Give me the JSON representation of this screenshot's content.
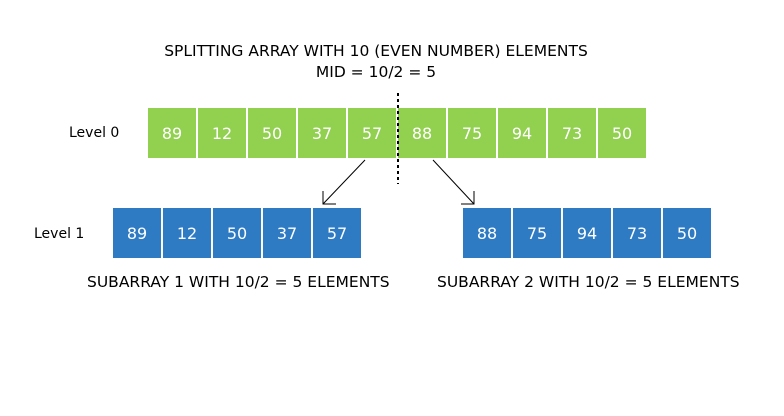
{
  "title": {
    "line1": "SPLITTING ARRAY WITH 10 (EVEN NUMBER) ELEMENTS",
    "line2": "MID = 10/2 = 5"
  },
  "levels": {
    "level0_label": "Level 0",
    "level1_label": "Level 1"
  },
  "array_level0": [
    "89",
    "12",
    "50",
    "37",
    "57",
    "88",
    "75",
    "94",
    "73",
    "50"
  ],
  "subarray1": [
    "89",
    "12",
    "50",
    "37",
    "57"
  ],
  "subarray2": [
    "88",
    "75",
    "94",
    "73",
    "50"
  ],
  "captions": {
    "subarray1": "SUBARRAY 1 WITH 10/2 = 5 ELEMENTS",
    "subarray2": "SUBARRAY 2 WITH 10/2 = 5 ELEMENTS"
  },
  "colors": {
    "level0_cell": "#92d050",
    "level1_cell": "#2e7bc4",
    "cell_text": "#ffffff"
  }
}
